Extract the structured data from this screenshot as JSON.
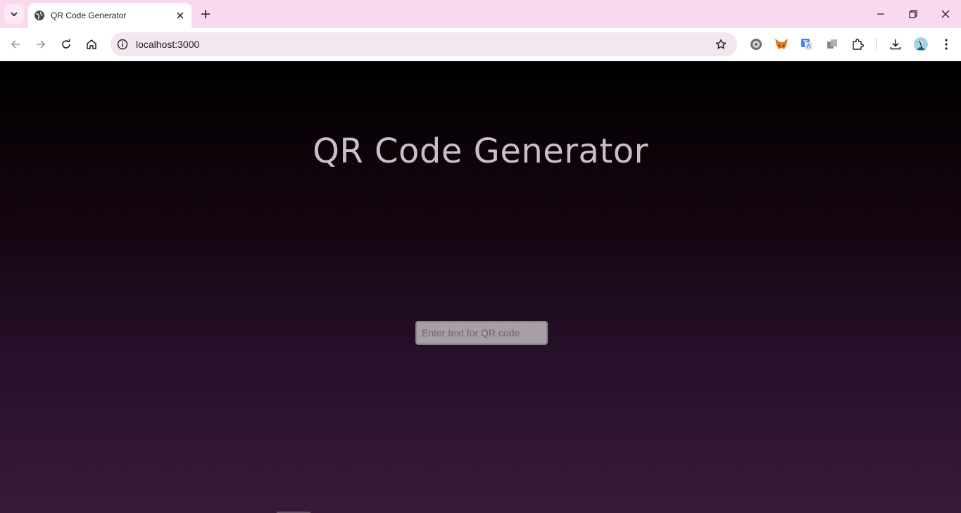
{
  "browser": {
    "tab_title": "QR Code Generator",
    "url": "localhost:3000",
    "icons": {
      "tab_search": "chevron-down-icon",
      "favicon": "globe-icon",
      "tab_close": "close-icon",
      "new_tab": "plus-icon",
      "minimize": "minimize-icon",
      "restore": "restore-icon",
      "close_window": "close-icon",
      "back": "arrow-left-icon",
      "forward": "arrow-right-icon",
      "reload": "reload-icon",
      "home": "home-icon",
      "site_info": "info-icon",
      "bookmark": "star-icon",
      "extensions": [
        "gear-extension-icon",
        "metamask-fox-icon",
        "translate-icon",
        "copy-extension-icon",
        "puzzle-icon"
      ],
      "downloads": "download-icon",
      "profile": "avatar",
      "menu": "kebab-menu-icon"
    }
  },
  "main": {
    "title": "QR Code Generator",
    "input_placeholder": "Enter text for QR code",
    "input_value": ""
  },
  "colors": {
    "tabstrip": "#f9d9ee",
    "page_gradient_top": "#000000",
    "page_gradient_bottom": "#381a38",
    "heading": "#c9bfc6",
    "input_bg": "#a89ea6"
  }
}
